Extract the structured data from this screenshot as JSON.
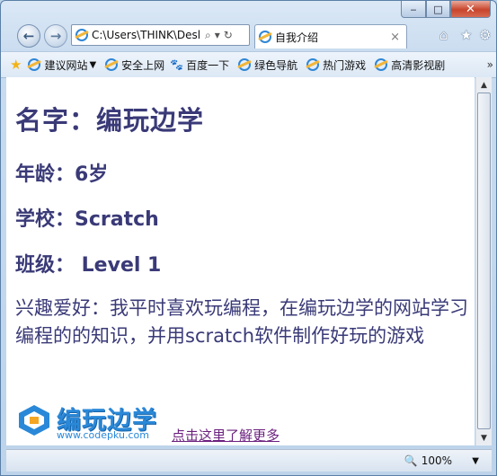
{
  "browser": {
    "address": "C:\\Users\\THINK\\Desl",
    "tab_title": "自我介绍",
    "tab_close": "×",
    "nav": {
      "back": "←",
      "forward": "→"
    },
    "address_tools": {
      "search": "⌕",
      "dropdown": "▾",
      "refresh": "↻"
    },
    "right_icons": {
      "home": "⌂",
      "favorites": "★",
      "tools": "⚙"
    },
    "caption": {
      "minimize": "‒",
      "maximize": "□",
      "close": "✕"
    }
  },
  "favorites_bar": {
    "items": [
      {
        "label": "建议网站",
        "has_dropdown": true
      },
      {
        "label": "安全上网"
      },
      {
        "label": "百度一下"
      },
      {
        "label": "绿色导航"
      },
      {
        "label": "热门游戏"
      },
      {
        "label": "高清影视剧"
      }
    ],
    "chevron": "»"
  },
  "page": {
    "name": "名字：编玩边学",
    "age": "年龄：6岁",
    "school": "学校：Scratch",
    "class": "班级： Level 1",
    "hobby": "兴趣爱好：我平时喜欢玩编程，在编玩边学的网站学习编程的的知识，并用scratch软件制作好玩的游戏",
    "logo_title": "编玩边学",
    "logo_url": "www.codepku.com",
    "learn_more_link": "点击这里了解更多"
  },
  "status_bar": {
    "zoom": "100%"
  },
  "colors": {
    "heading": "#3a3a78",
    "link": "#6b1f7e",
    "logo_blue": "#2a88d8",
    "logo_orange": "#f5a623"
  }
}
